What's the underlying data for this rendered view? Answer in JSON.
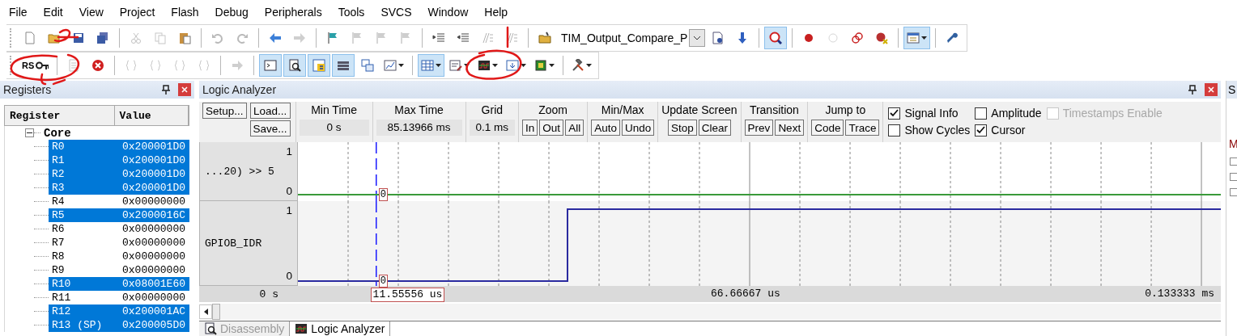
{
  "menu": [
    "File",
    "Edit",
    "View",
    "Project",
    "Flash",
    "Debug",
    "Peripherals",
    "Tools",
    "SVCS",
    "Window",
    "Help"
  ],
  "toolbars": [
    {
      "items": [
        {
          "kind": "button",
          "active": false,
          "disabled": false
        },
        {
          "kind": "button",
          "active": false,
          "disabled": false
        },
        {
          "kind": "button",
          "active": false,
          "disabled": false
        },
        {
          "kind": "button",
          "active": false,
          "disabled": false
        },
        {
          "kind": "separator"
        },
        {
          "kind": "button",
          "active": false,
          "disabled": true
        },
        {
          "kind": "button",
          "active": false,
          "disabled": true
        },
        {
          "kind": "button",
          "active": false,
          "disabled": false
        },
        {
          "kind": "separator"
        },
        {
          "kind": "button",
          "active": false,
          "disabled": true
        },
        {
          "kind": "button",
          "active": false,
          "disabled": true
        },
        {
          "kind": "separator"
        },
        {
          "kind": "button",
          "active": false,
          "disabled": false
        },
        {
          "kind": "button",
          "active": false,
          "disabled": true
        },
        {
          "kind": "separator"
        },
        {
          "kind": "button",
          "active": false,
          "disabled": false
        },
        {
          "kind": "button",
          "active": false,
          "disabled": true
        },
        {
          "kind": "button",
          "active": false,
          "disabled": true
        },
        {
          "kind": "button",
          "active": false,
          "disabled": true
        },
        {
          "kind": "separator"
        },
        {
          "kind": "button",
          "active": false,
          "disabled": false
        },
        {
          "kind": "button",
          "active": false,
          "disabled": false
        },
        {
          "kind": "button",
          "active": false,
          "disabled": true
        },
        {
          "kind": "button",
          "active": false,
          "disabled": true
        },
        {
          "kind": "separator"
        },
        {
          "kind": "button",
          "active": false,
          "disabled": false
        },
        {
          "kind": "combo",
          "value": "TIM_Output_Compare_P"
        },
        {
          "kind": "button",
          "active": false,
          "disabled": false
        },
        {
          "kind": "button",
          "active": false,
          "disabled": false
        },
        {
          "kind": "separator"
        },
        {
          "kind": "button",
          "active": true,
          "disabled": false
        },
        {
          "kind": "separator"
        },
        {
          "kind": "button",
          "active": false,
          "disabled": false
        },
        {
          "kind": "button",
          "active": false,
          "disabled": true
        },
        {
          "kind": "button",
          "active": false,
          "disabled": false
        },
        {
          "kind": "button",
          "active": false,
          "disabled": false
        },
        {
          "kind": "separator"
        },
        {
          "kind": "split",
          "active": true,
          "disabled": false
        },
        {
          "kind": "separator"
        },
        {
          "kind": "button",
          "active": false,
          "disabled": false
        }
      ]
    },
    {
      "items": [
        {
          "kind": "button",
          "active": false,
          "disabled": false,
          "label": "RS"
        },
        {
          "kind": "separator"
        },
        {
          "kind": "button",
          "active": false,
          "disabled": true
        },
        {
          "kind": "button",
          "active": false,
          "disabled": false
        },
        {
          "kind": "separator"
        },
        {
          "kind": "button",
          "active": false,
          "disabled": true
        },
        {
          "kind": "button",
          "active": false,
          "disabled": true
        },
        {
          "kind": "button",
          "active": false,
          "disabled": true
        },
        {
          "kind": "button",
          "active": false,
          "disabled": true
        },
        {
          "kind": "separator"
        },
        {
          "kind": "button",
          "active": false,
          "disabled": true
        },
        {
          "kind": "separator"
        },
        {
          "kind": "button",
          "active": true,
          "disabled": false
        },
        {
          "kind": "button",
          "active": true,
          "disabled": false
        },
        {
          "kind": "button",
          "active": true,
          "disabled": false
        },
        {
          "kind": "button",
          "active": true,
          "disabled": false
        },
        {
          "kind": "button",
          "active": false,
          "disabled": false
        },
        {
          "kind": "split",
          "active": false,
          "disabled": false
        },
        {
          "kind": "separator"
        },
        {
          "kind": "split",
          "active": true,
          "disabled": false
        },
        {
          "kind": "split",
          "active": false,
          "disabled": false
        },
        {
          "kind": "split",
          "active": false,
          "disabled": false
        },
        {
          "kind": "split",
          "active": false,
          "disabled": false
        },
        {
          "kind": "split",
          "active": false,
          "disabled": false
        },
        {
          "kind": "separator"
        },
        {
          "kind": "split",
          "active": false,
          "disabled": false
        }
      ]
    }
  ],
  "registers": {
    "title": "Registers",
    "columns": [
      "Register",
      "Value"
    ],
    "tree": [
      {
        "name": "Core",
        "expanded": true,
        "children": [
          {
            "name": "R0",
            "value": "0x200001D0",
            "selected": true
          },
          {
            "name": "R1",
            "value": "0x200001D0",
            "selected": true
          },
          {
            "name": "R2",
            "value": "0x200001D0",
            "selected": true
          },
          {
            "name": "R3",
            "value": "0x200001D0",
            "selected": true
          },
          {
            "name": "R4",
            "value": "0x00000000",
            "selected": false
          },
          {
            "name": "R5",
            "value": "0x2000016C",
            "selected": true
          },
          {
            "name": "R6",
            "value": "0x00000000",
            "selected": false
          },
          {
            "name": "R7",
            "value": "0x00000000",
            "selected": false
          },
          {
            "name": "R8",
            "value": "0x00000000",
            "selected": false
          },
          {
            "name": "R9",
            "value": "0x00000000",
            "selected": false
          },
          {
            "name": "R10",
            "value": "0x08001E60",
            "selected": true
          },
          {
            "name": "R11",
            "value": "0x00000000",
            "selected": false
          },
          {
            "name": "R12",
            "value": "0x200001AC",
            "selected": true
          },
          {
            "name": "R13 (SP)",
            "value": "0x200005D0",
            "selected": true
          }
        ]
      }
    ]
  },
  "logic_analyzer": {
    "title": "Logic Analyzer",
    "file_buttons": [
      "Setup...",
      "Load...",
      "Save..."
    ],
    "readouts": [
      {
        "title": "Min Time",
        "value": "0 s"
      },
      {
        "title": "Max Time",
        "value": "85.13966 ms"
      },
      {
        "title": "Grid",
        "value": "0.1 ms"
      }
    ],
    "button_groups": [
      {
        "title": "Zoom",
        "buttons": [
          "In",
          "Out",
          "All"
        ]
      },
      {
        "title": "Min/Max",
        "buttons": [
          "Auto",
          "Undo"
        ]
      },
      {
        "title": "Update Screen",
        "buttons": [
          "Stop",
          "Clear"
        ]
      },
      {
        "title": "Transition",
        "buttons": [
          "Prev",
          "Next"
        ]
      },
      {
        "title": "Jump to",
        "buttons": [
          "Code",
          "Trace"
        ]
      }
    ],
    "options": [
      {
        "label": "Signal Info",
        "checked": true,
        "disabled": false
      },
      {
        "label": "Show Cycles",
        "checked": false,
        "disabled": false
      },
      {
        "label": "Amplitude",
        "checked": false,
        "disabled": false
      },
      {
        "label": "Cursor",
        "checked": true,
        "disabled": false
      },
      {
        "label": "Timestamps Enable",
        "checked": false,
        "disabled": true
      }
    ],
    "signals": [
      {
        "name": "...20) >> 5",
        "max": "1",
        "min": "0",
        "color": "#3a9a3a",
        "cursor_value": "0"
      },
      {
        "name": "GPIOB_IDR",
        "max": "1",
        "min": "0",
        "color": "#2a2aa0",
        "cursor_value": "0"
      }
    ],
    "cursor": {
      "label": "11.55556 us"
    },
    "axis_labels": [
      "0 s",
      "66.66667 us",
      "0.133333 ms"
    ],
    "tabs": [
      {
        "label": "Disassembly",
        "selected": false
      },
      {
        "label": "Logic Analyzer",
        "selected": true
      }
    ]
  },
  "side_panel": {
    "title": "S",
    "item": "M"
  }
}
